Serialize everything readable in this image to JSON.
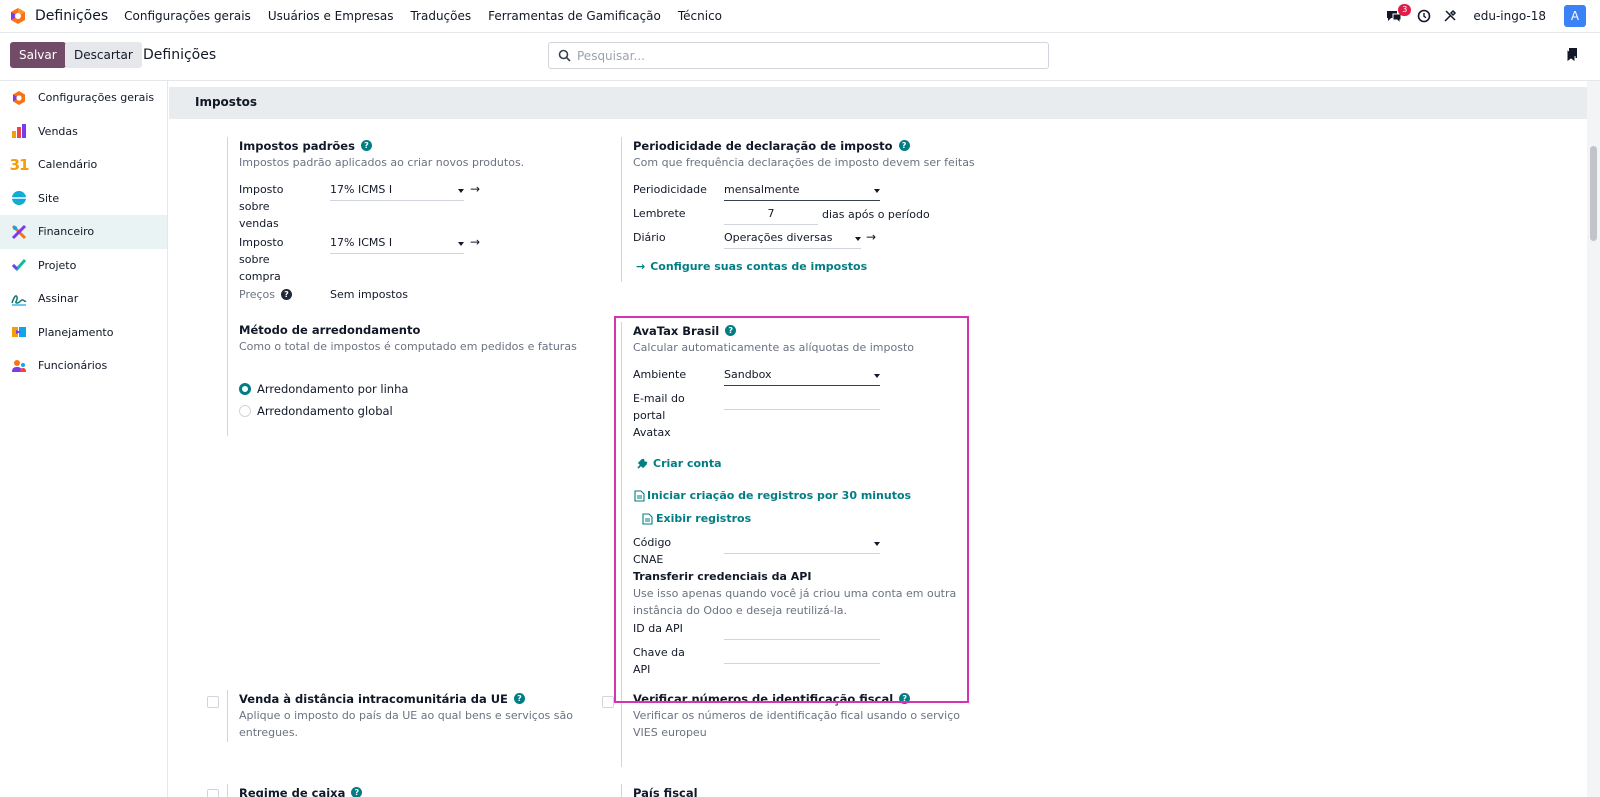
{
  "navbar": {
    "app_title": "Definições",
    "menu": [
      "Configurações gerais",
      "Usuários e Empresas",
      "Traduções",
      "Ferramentas de Gamificação",
      "Técnico"
    ],
    "chat_count": "3",
    "username": "edu-ingo-18",
    "avatar_letter": "A"
  },
  "control": {
    "save_label": "Salvar",
    "discard_label": "Descartar",
    "breadcrumb": "Definições",
    "search_placeholder": "Pesquisar..."
  },
  "sidebar": {
    "items": [
      {
        "label": "Configurações gerais",
        "icon": "settings-app-icon"
      },
      {
        "label": "Vendas",
        "icon": "sales-app-icon"
      },
      {
        "label": "Calendário",
        "icon": "calendar-app-icon"
      },
      {
        "label": "Site",
        "icon": "website-app-icon"
      },
      {
        "label": "Financeiro",
        "icon": "accounting-app-icon"
      },
      {
        "label": "Projeto",
        "icon": "project-app-icon"
      },
      {
        "label": "Assinar",
        "icon": "sign-app-icon"
      },
      {
        "label": "Planejamento",
        "icon": "planning-app-icon"
      },
      {
        "label": "Funcionários",
        "icon": "employees-app-icon"
      }
    ],
    "calendar_number": "31"
  },
  "section": {
    "title": "Impostos"
  },
  "default_taxes": {
    "title": "Impostos padrões",
    "desc": "Impostos padrão aplicados ao criar novos produtos.",
    "sales_label_1": "Imposto",
    "sales_label_2": "sobre",
    "sales_label_3": "vendas",
    "sales_value": "17% ICMS I",
    "purchase_label_1": "Imposto",
    "purchase_label_2": "sobre",
    "purchase_label_3": "compra",
    "purchase_value": "17% ICMS I",
    "prices_label": "Preços",
    "prices_value": "Sem impostos"
  },
  "tax_periodicity": {
    "title": "Periodicidade de declaração de imposto",
    "desc": "Com que frequência declarações de imposto devem ser feitas",
    "periodicity_label": "Periodicidade",
    "periodicity_value": "mensalmente",
    "reminder_label": "Lembrete",
    "reminder_value": "7",
    "reminder_suffix": "dias após o período",
    "journal_label": "Diário",
    "journal_value": "Operações diversas",
    "configure_link": "Configure suas contas de impostos"
  },
  "rounding": {
    "title": "Método de arredondamento",
    "desc": "Como o total de impostos é computado em pedidos e faturas",
    "option_line": "Arredondamento por linha",
    "option_global": "Arredondamento global"
  },
  "avatax": {
    "title": "AvaTax Brasil",
    "desc": "Calcular automaticamente as alíquotas de imposto",
    "env_label": "Ambiente",
    "env_value": "Sandbox",
    "email_label_1": "E-mail do",
    "email_label_2": "portal",
    "email_label_3": "Avatax",
    "create_account": "Criar conta",
    "start_logging": "Iniciar criação de registros por 30 minutos",
    "show_logs": "Exibir registros",
    "cnae_label_1": "Código",
    "cnae_label_2": "CNAE",
    "transfer_title": "Transferir credenciais da API",
    "transfer_desc_1": "Use isso apenas quando você já criou uma conta em outra",
    "transfer_desc_2": "instância do Odoo e deseja reutilizá-la.",
    "api_id_label": "ID da API",
    "api_key_label_1": "Chave da",
    "api_key_label_2": "API"
  },
  "eu_distance": {
    "title": "Venda à distância intracomunitária da UE",
    "desc_1": "Aplique o imposto do país da UE ao qual bens e serviços são",
    "desc_2": "entregues."
  },
  "vat_check": {
    "title": "Verificar números de identificação fiscal",
    "desc_1": "Verificar os números de identificação fical usando o serviço",
    "desc_2": "VIES europeu"
  },
  "cash_basis": {
    "title": "Regime de caixa"
  },
  "fiscal_country": {
    "title": "País fiscal"
  }
}
